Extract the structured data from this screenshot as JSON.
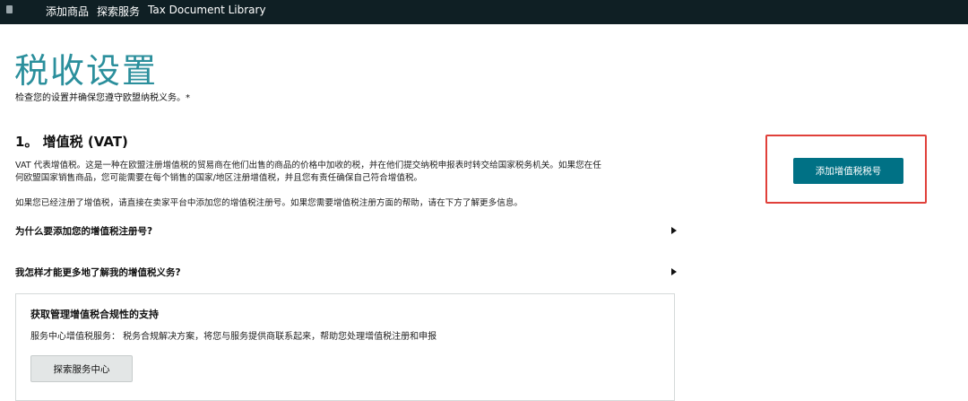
{
  "topnav": {
    "items": [
      {
        "label": "添加商品"
      },
      {
        "label": "探索服务"
      },
      {
        "label": "Tax Document Library"
      }
    ]
  },
  "page": {
    "title": "税收设置",
    "subtitle": "检查您的设置并确保您遵守欧盟纳税义务。*"
  },
  "vat_section": {
    "heading": "1。 增值税 (VAT)",
    "paragraph1_line1": "VAT 代表增值税。这是一种在欧盟注册增值税的贸易商在他们出售的商品的价格中加收的税，并在他们提交纳税申报表时转交给国家税务机关。如果您在任",
    "paragraph1_line2": "何欧盟国家销售商品，您可能需要在每个销售的国家/地区注册增值税，并且您有责任确保自己符合增值税。",
    "paragraph2": "如果您已经注册了增值税，请直接在卖家平台中添加您的增值税注册号。如果您需要增值税注册方面的帮助，请在下方了解更多信息。",
    "faq": [
      {
        "label": "为什么要添加您的增值税注册号?"
      },
      {
        "label": "我怎样才能更多地了解我的增值税义务?"
      }
    ]
  },
  "support": {
    "title": "获取管理增值税合规性的支持",
    "text": "服务中心增值税服务：  税务合规解决方案，将您与服务提供商联系起来，帮助您处理增值税注册和申报",
    "button_label": "探索服务中心"
  },
  "actions": {
    "add_vat_label": "添加增值税税号"
  },
  "colors": {
    "nav_bg": "#0f1f24",
    "title": "#2b8f9c",
    "primary_button": "#007185",
    "highlight": "#e0403a"
  }
}
